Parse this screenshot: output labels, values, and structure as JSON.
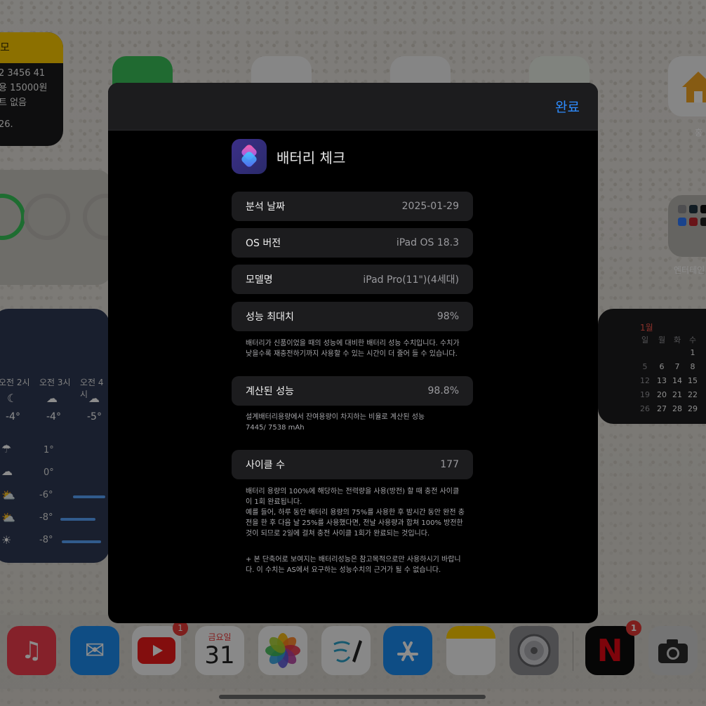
{
  "background": {
    "note_widget": {
      "header": "모",
      "lines": [
        "2 3456 41",
        "용 15000원",
        "트 없음",
        "26."
      ]
    },
    "weather_widget": {
      "hours": [
        {
          "label": "오전 2시",
          "icon": "moon-cloud-icon",
          "temp": "-4°"
        },
        {
          "label": "오전 3시",
          "icon": "cloud-moon-icon",
          "temp": "-4°"
        },
        {
          "label": "오전 4시",
          "icon": "cloud-moon-icon",
          "temp": "-5°"
        }
      ],
      "daily": [
        {
          "icon": "rain-cloud-icon",
          "temp": "1°"
        },
        {
          "icon": "cloud-icon",
          "temp": "0°"
        },
        {
          "icon": "sun-cloud-icon",
          "temp": "-6°"
        },
        {
          "icon": "sun-cloud-icon",
          "temp": "-8°"
        },
        {
          "icon": "sun-icon",
          "temp": "-8°"
        }
      ]
    },
    "calendar_widget": {
      "month": "1월",
      "weekdays": [
        "일",
        "월",
        "화",
        "수"
      ],
      "rows": [
        [
          "",
          "",
          "",
          "1"
        ],
        [
          "5",
          "6",
          "7",
          "8"
        ],
        [
          "12",
          "13",
          "14",
          "15"
        ],
        [
          "19",
          "20",
          "21",
          "22"
        ],
        [
          "26",
          "27",
          "28",
          "29"
        ]
      ]
    },
    "home_label": "홍",
    "folder_label": "엔터테인"
  },
  "dock": {
    "calendar_day": "금요일",
    "calendar_date": "31",
    "youtube_badge": "1",
    "netflix_badge": "1",
    "netflix_letter": "N"
  },
  "sheet": {
    "done_label": "완료",
    "shortcut_title": "배터리 체크",
    "rows": [
      {
        "key": "분석 날짜",
        "value": "2025-01-29"
      },
      {
        "key": "OS 버전",
        "value": "iPad OS 18.3"
      },
      {
        "key": "모델명",
        "value": "iPad Pro(11\")(4세대)"
      },
      {
        "key": "성능 최대치",
        "value": "98%"
      },
      {
        "key": "계산된 성능",
        "value": "98.8%"
      },
      {
        "key": "사이클 수",
        "value": "177"
      }
    ],
    "note_max": "배터리가 신품이었을 때의 성능에 대비한 배터리 성능 수치입니다. 수치가 낮을수록 재충전하기까지 사용할 수 있는 시간이 더 줄어 들 수 있습니다.",
    "note_calc_1": "설계배터리용량에서 잔여용량이 차지하는 비율로 계산된 성능",
    "note_calc_2": "7445/ 7538 mAh",
    "note_cycle_1": "배터리 용량의 100%에 해당하는 전력량을 사용(방전) 할 때 충전 사이클이 1회 완료됩니다.",
    "note_cycle_2": "예를 들어, 하루 동안 배터리 용량의 75%를 사용한 후 밤시간 동안 완전 충전을 한 후 다음 날 25%를 사용했다면, 전날 사용량과 합쳐 100% 방전한 것이 되므로 2일에 걸쳐 충전 사이클 1회가 완료되는 것입니다.",
    "note_disclaimer": "+ 본 단축어로 보여지는 배터리성능은 참고목적으로만 사용하시기 바랍니다. 이 수치는 AS에서 요구하는 성능수치의 근거가 될 수 없습니다."
  }
}
